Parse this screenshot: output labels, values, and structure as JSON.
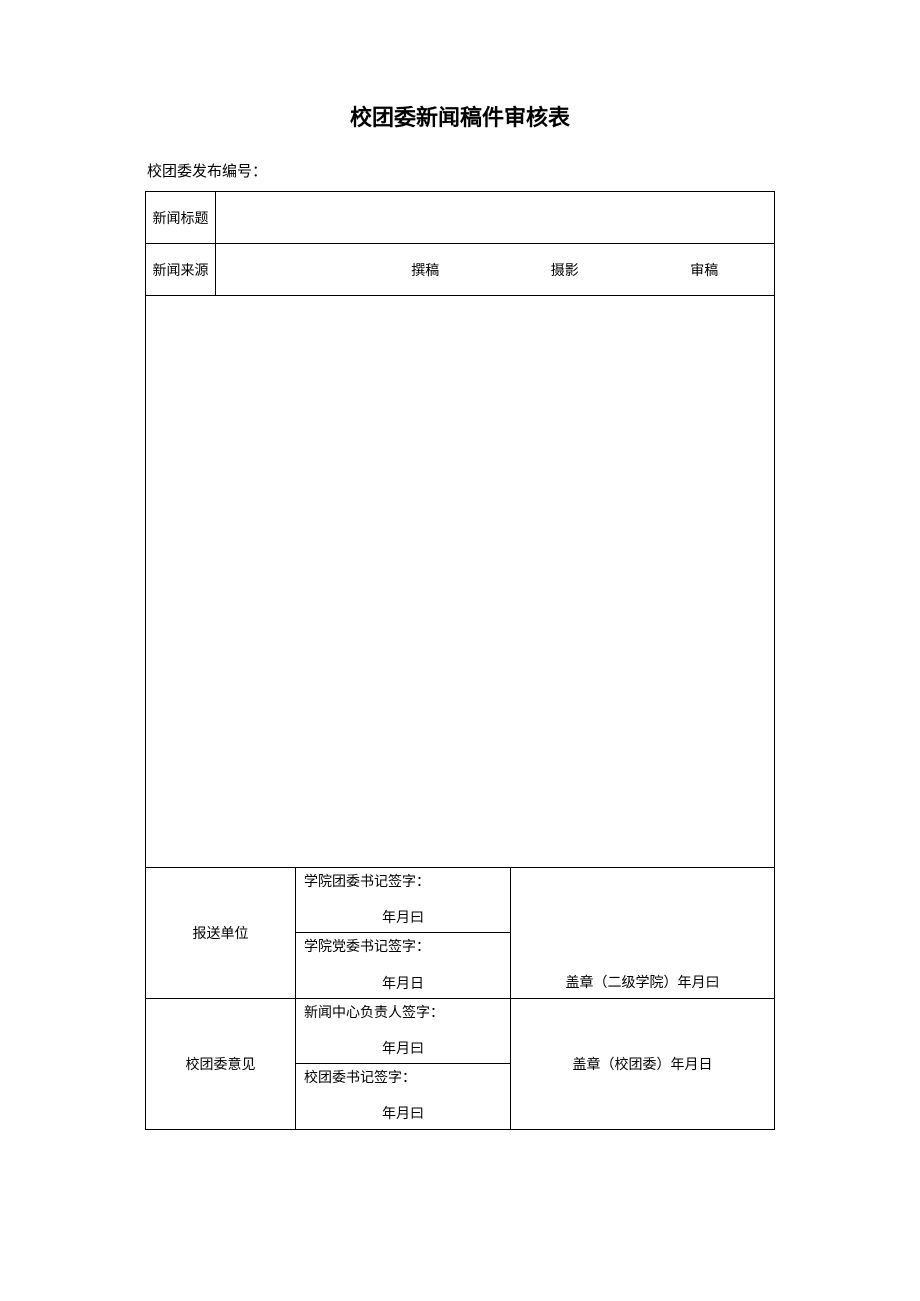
{
  "title": "校团委新闻稿件审核表",
  "pre_label": "校团委发布编号：",
  "row1_label": "新闻标题",
  "row2_label": "新闻来源",
  "fields": {
    "writer": "撰稿",
    "photo": "摄影",
    "review": "审稿"
  },
  "sig1": {
    "label": "报送单位",
    "line1": "学院团委书记签字：",
    "date1": "年月曰",
    "line2": "学院党委书记签字：",
    "date2": "年月日",
    "stamp": "盖章（二级学院）年月曰"
  },
  "sig2": {
    "label": "校团委意见",
    "line1": "新闻中心负责人签字：",
    "date1": "年月曰",
    "line2": "校团委书记签字：",
    "date2": "年月曰",
    "stamp": "盖章（校团委）年月日"
  }
}
